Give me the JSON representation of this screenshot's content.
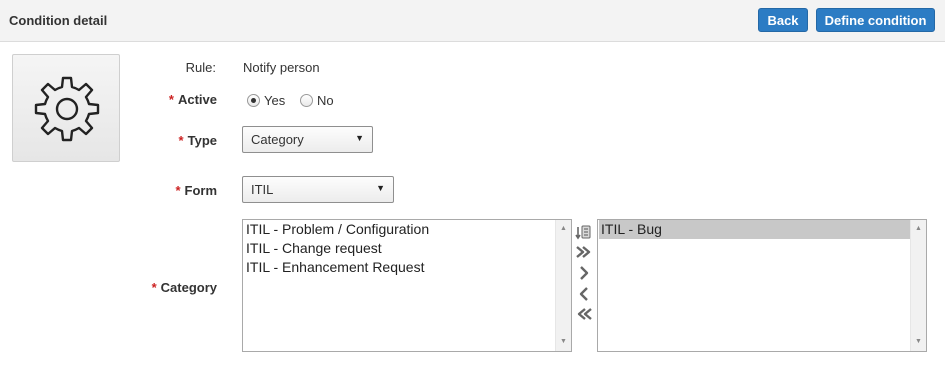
{
  "header": {
    "title": "Condition detail",
    "back_label": "Back",
    "define_label": "Define condition",
    "button_color": "#2c7cc4"
  },
  "form": {
    "rule": {
      "label": "Rule:",
      "value": "Notify person"
    },
    "active": {
      "label": "Active",
      "required": true,
      "options": [
        {
          "label": "Yes",
          "checked": true
        },
        {
          "label": "No",
          "checked": false
        }
      ]
    },
    "type": {
      "label": "Type",
      "required": true,
      "selected": "Category"
    },
    "form_field": {
      "label": "Form",
      "required": true,
      "selected": "ITIL"
    },
    "category": {
      "label": "Category",
      "required": true,
      "available": [
        "ITIL - Problem / Configuration",
        "ITIL - Change request",
        "ITIL - Enhancement Request"
      ],
      "chosen": [
        "ITIL - Bug"
      ],
      "controls": [
        "sort-icon",
        "move-all-right-icon",
        "move-right-icon",
        "move-left-icon",
        "move-all-left-icon"
      ]
    }
  },
  "colors": {
    "required_star": "#cc2222",
    "selected_row": "#c8c8c8"
  }
}
